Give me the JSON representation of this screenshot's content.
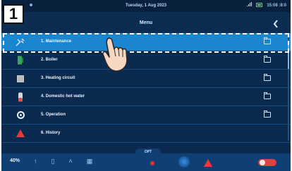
{
  "step_number": "1",
  "statusbar": {
    "date": "Tuesday, 1 Aug 2023",
    "time": "15:08 :8:0"
  },
  "header": {
    "title": "Menu",
    "back_icon": "back-chevron-icon"
  },
  "menu": {
    "items": [
      {
        "label": "1. Maintenance",
        "icon": "wrench-icon",
        "active": true
      },
      {
        "label": "2. Boiler",
        "icon": "boiler-icon",
        "active": false
      },
      {
        "label": "3. Heating circuit",
        "icon": "radiator-icon",
        "active": false
      },
      {
        "label": "4. Domestic hot water",
        "icon": "water-cylinder-icon",
        "active": false
      },
      {
        "label": "5. Operation",
        "icon": "gear-icon",
        "active": false
      },
      {
        "label": "6. History",
        "icon": "warning-icon",
        "active": false
      }
    ]
  },
  "bottombar": {
    "opt_label": "OPT",
    "left_label": "40%"
  },
  "colors": {
    "background": "#0b2a4f",
    "active_row": "#1a86d0",
    "alert": "#e83a3a"
  }
}
